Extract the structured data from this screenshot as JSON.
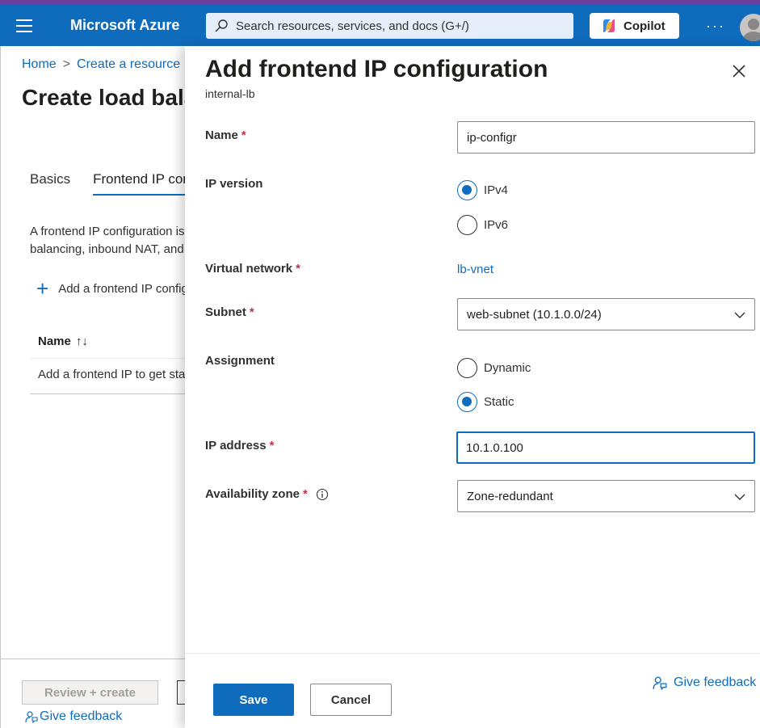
{
  "header": {
    "brand": "Microsoft Azure",
    "search_placeholder": "Search resources, services, and docs (G+/)",
    "copilot_label": "Copilot",
    "more_label": "···"
  },
  "background_page": {
    "breadcrumb": [
      "Home",
      "Create a resource"
    ],
    "title": "Create load balancer",
    "tabs": [
      "Basics",
      "Frontend IP configuration"
    ],
    "description_lines": [
      "A frontend IP configuration is an IP address used for inbound and/or outbound traffic. It is the load",
      "balancing, inbound NAT, and outbound rules"
    ],
    "add_button_label": "Add a frontend IP configuration",
    "table_header_name": "Name",
    "sort_icon": "↑↓",
    "table_empty_text": "Add a frontend IP to get started",
    "review_create_label": "Review + create",
    "give_feedback_label": "Give feedback"
  },
  "blade": {
    "title": "Add frontend IP configuration",
    "subtitle": "internal-lb",
    "fields": {
      "name": {
        "label": "Name",
        "required": "*",
        "value": "ip-configr"
      },
      "ip_version": {
        "label": "IP version",
        "options": [
          "IPv4",
          "IPv6"
        ],
        "selected": "IPv4"
      },
      "virtual_network": {
        "label": "Virtual network",
        "required": "*",
        "value": "lb-vnet"
      },
      "subnet": {
        "label": "Subnet",
        "required": "*",
        "value": "web-subnet (10.1.0.0/24)"
      },
      "assignment": {
        "label": "Assignment",
        "options": [
          "Dynamic",
          "Static"
        ],
        "selected": "Static"
      },
      "ip_address": {
        "label": "IP address",
        "required": "*",
        "value": "10.1.0.100"
      },
      "availability_zone": {
        "label": "Availability zone",
        "required": "*",
        "value": "Zone-redundant"
      }
    },
    "save_label": "Save",
    "cancel_label": "Cancel",
    "give_feedback_label": "Give feedback"
  },
  "colors": {
    "accent": "#0f6cbd",
    "topbar": "#0f6cbd",
    "top_stripe": "#6b3fa0",
    "required": "#c4314b"
  }
}
